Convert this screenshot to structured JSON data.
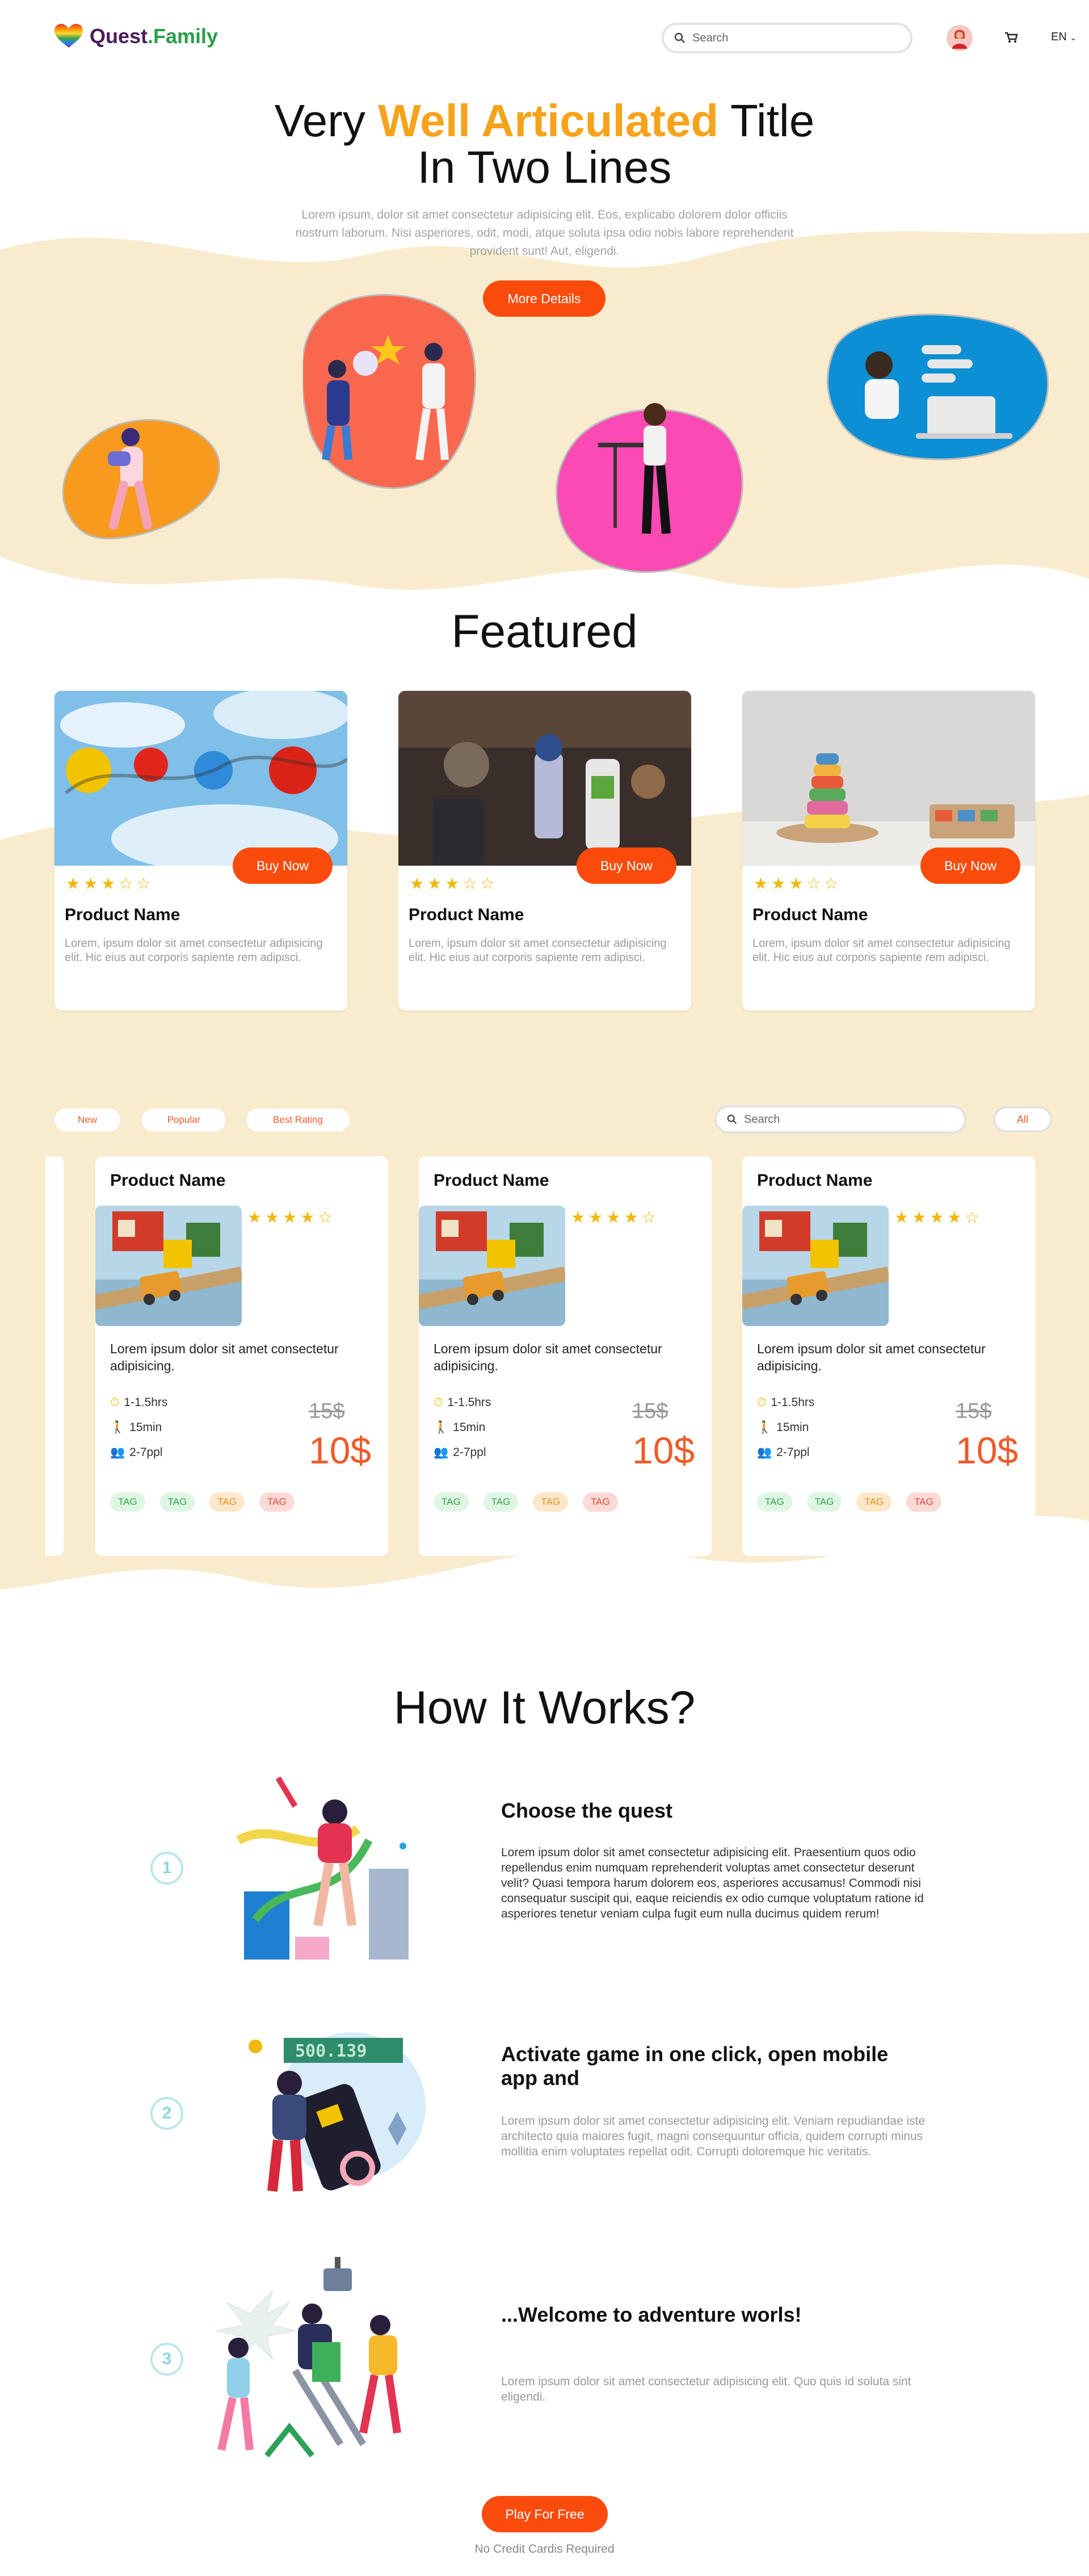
{
  "header": {
    "logo_text": "Quest",
    "logo_text_suffix": ".Family",
    "search_placeholder": "Search",
    "language": "EN"
  },
  "hero": {
    "title_before": "Very ",
    "title_highlight": "Well Articulated",
    "title_after": " Title",
    "title_line2": "In Two Lines",
    "text": "Lorem ipsum, dolor sit amet consectetur adipisicing elit. Eos, explicabo dolorem dolor officiis nostrum laborum. Nisi asperiores, odit, modi, atque soluta ipsa odio nobis labore reprehenderit provident sunt! Aut, eligendi.",
    "button": "More Details"
  },
  "featured": {
    "title": "Featured",
    "cards": [
      {
        "name": "Product Name",
        "desc": "Lorem, ipsum dolor sit amet consectetur adipisicing elit. Hic eius aut corporis sapiente rem adipisci.",
        "button": "Buy Now",
        "rating": 3
      },
      {
        "name": "Product Name",
        "desc": "Lorem, ipsum dolor sit amet consectetur adipisicing elit. Hic eius aut corporis sapiente rem adipisci.",
        "button": "Buy Now",
        "rating": 3
      },
      {
        "name": "Product Name",
        "desc": "Lorem, ipsum dolor sit amet consectetur adipisicing elit. Hic eius aut corporis sapiente rem adipisci.",
        "button": "Buy Now",
        "rating": 3
      }
    ]
  },
  "filters": {
    "tabs": [
      "New",
      "Popular",
      "Best Rating"
    ],
    "search_placeholder": "Search",
    "select_value": "All"
  },
  "products": [
    {
      "name": "Product Name",
      "rating": 4,
      "desc": "Lorem ipsum dolor sit amet consectetur adipisicing.",
      "duration": "1-1.5hrs",
      "step_time": "15min",
      "people": "2-7ppl",
      "old_price": "15$",
      "price": "10$",
      "tags": [
        "TAG",
        "TAG",
        "TAG",
        "TAG"
      ]
    },
    {
      "name": "Product Name",
      "rating": 4,
      "desc": "Lorem ipsum dolor sit amet consectetur adipisicing.",
      "duration": "1-1.5hrs",
      "step_time": "15min",
      "people": "2-7ppl",
      "old_price": "15$",
      "price": "10$",
      "tags": [
        "TAG",
        "TAG",
        "TAG",
        "TAG"
      ]
    },
    {
      "name": "Product Name",
      "rating": 4,
      "desc": "Lorem ipsum dolor sit amet consectetur adipisicing.",
      "duration": "1-1.5hrs",
      "step_time": "15min",
      "people": "2-7ppl",
      "old_price": "15$",
      "price": "10$",
      "tags": [
        "TAG",
        "TAG",
        "TAG",
        "TAG"
      ]
    }
  ],
  "how": {
    "title": "How It Works?",
    "steps": [
      {
        "num": "1",
        "title": "Choose the quest",
        "text": "Lorem ipsum dolor sit amet consectetur adipisicing elit. Praesentium quos odio repellendus enim numquam reprehenderit voluptas amet consectetur deserunt velit? Quasi tempora harum dolorem eos, asperiores accusamus! Commodi nisi consequatur suscipit qui, eaque reiciendis ex odio cumque voluptatum ratione id asperiores tenetur veniam culpa fugit eum nulla ducimus quidem rerum!"
      },
      {
        "num": "2",
        "title": "Activate game in one click, open mobile app and",
        "text": "Lorem ipsum dolor sit amet consectetur adipisicing elit. Veniam repudiandae iste architecto quia maiores fugit, magni consequuntur officia, quidem corrupti minus mollitia enim voluptates repellat odit. Corrupti doloremque hic veritatis.",
        "counter": "500.139"
      },
      {
        "num": "3",
        "title": "...Welcome to adventure worls!",
        "text": "Lorem ipsum dolor sit amet consectetur adipisicing elit. Quo quis id soluta sint eligendi."
      }
    ],
    "cta": "Play For Free",
    "cta_note": "No Credit Cardis Required"
  },
  "colors": {
    "accent": "#fb4b0c",
    "highlight": "#f6a31b",
    "wave": "#f9ecce",
    "star": "#f2b70c"
  }
}
